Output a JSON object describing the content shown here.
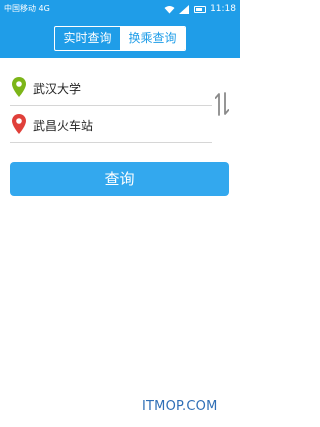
{
  "status_bar": {
    "carrier": "中国移动 4G",
    "time": "11:18"
  },
  "header": {
    "tabs": [
      {
        "label": "实时查询",
        "active": false
      },
      {
        "label": "换乘查询",
        "active": true
      }
    ]
  },
  "form": {
    "start_label": "武汉大学",
    "end_label": "武昌火车站",
    "start_icon": "pin-green-icon",
    "end_icon": "pin-red-icon",
    "swap_icon": "swap-icon"
  },
  "query_button_label": "查询",
  "watermark": "ITMOP.COM",
  "colors": {
    "header": "#1f9de8",
    "button": "#33a8ee",
    "start_pin": "#7cb518",
    "end_pin": "#e0403a"
  }
}
